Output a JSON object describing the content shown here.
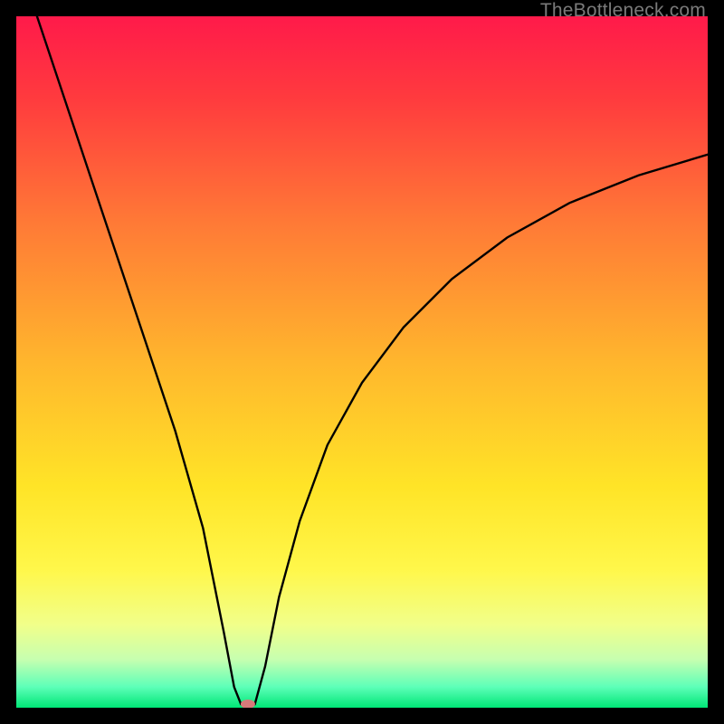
{
  "watermark": "TheBottleneck.com",
  "chart_data": {
    "type": "line",
    "title": "",
    "xlabel": "",
    "ylabel": "",
    "xlim": [
      0,
      100
    ],
    "ylim": [
      0,
      100
    ],
    "notch_x": 33,
    "marker": {
      "x": 33.5,
      "y": 0,
      "color": "#d67a7a"
    },
    "curve_left": [
      {
        "x": 3,
        "y": 100
      },
      {
        "x": 7,
        "y": 88
      },
      {
        "x": 11,
        "y": 76
      },
      {
        "x": 15,
        "y": 64
      },
      {
        "x": 19,
        "y": 52
      },
      {
        "x": 23,
        "y": 40
      },
      {
        "x": 27,
        "y": 26
      },
      {
        "x": 30,
        "y": 11
      },
      {
        "x": 31.5,
        "y": 3
      },
      {
        "x": 32.5,
        "y": 0.5
      }
    ],
    "curve_right": [
      {
        "x": 34.5,
        "y": 0.5
      },
      {
        "x": 36,
        "y": 6
      },
      {
        "x": 38,
        "y": 16
      },
      {
        "x": 41,
        "y": 27
      },
      {
        "x": 45,
        "y": 38
      },
      {
        "x": 50,
        "y": 47
      },
      {
        "x": 56,
        "y": 55
      },
      {
        "x": 63,
        "y": 62
      },
      {
        "x": 71,
        "y": 68
      },
      {
        "x": 80,
        "y": 73
      },
      {
        "x": 90,
        "y": 77
      },
      {
        "x": 100,
        "y": 80
      }
    ],
    "gradient_stops": [
      {
        "offset": 0.0,
        "color": "#ff1a4a"
      },
      {
        "offset": 0.12,
        "color": "#ff3b3e"
      },
      {
        "offset": 0.3,
        "color": "#ff7a36"
      },
      {
        "offset": 0.5,
        "color": "#ffb62d"
      },
      {
        "offset": 0.68,
        "color": "#ffe427"
      },
      {
        "offset": 0.8,
        "color": "#fff74a"
      },
      {
        "offset": 0.88,
        "color": "#f1ff8a"
      },
      {
        "offset": 0.93,
        "color": "#c7ffb0"
      },
      {
        "offset": 0.97,
        "color": "#5dffb8"
      },
      {
        "offset": 1.0,
        "color": "#00e676"
      }
    ]
  }
}
